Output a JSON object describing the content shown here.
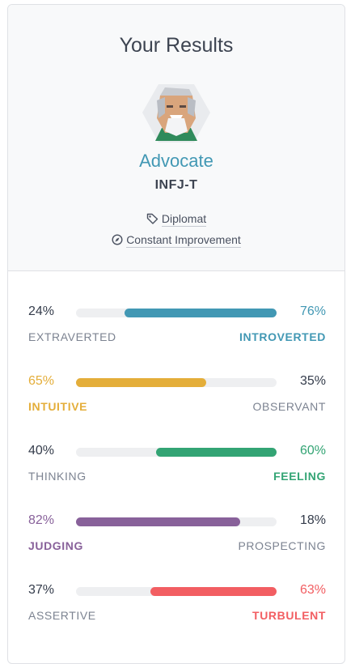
{
  "header": {
    "title": "Your Results",
    "personality_name": "Advocate",
    "code": "INFJ-T",
    "role": "Diplomat",
    "strategy": "Constant Improvement"
  },
  "colors": {
    "advocate": "#4298b4",
    "mind": "#4298b4",
    "energy": "#e4ae3a",
    "nature": "#33a474",
    "tactics": "#88619a",
    "identity": "#f25e62",
    "neutral_text": "#7c8391",
    "dark_text": "#343c4b"
  },
  "traits": [
    {
      "left_pct": "24%",
      "right_pct": "76%",
      "left_label": "EXTRAVERTED",
      "right_label": "INTROVERTED",
      "dominant": "right",
      "dominant_fraction": 0.76,
      "color": "#4298b4"
    },
    {
      "left_pct": "65%",
      "right_pct": "35%",
      "left_label": "INTUITIVE",
      "right_label": "OBSERVANT",
      "dominant": "left",
      "dominant_fraction": 0.65,
      "color": "#e4ae3a"
    },
    {
      "left_pct": "40%",
      "right_pct": "60%",
      "left_label": "THINKING",
      "right_label": "FEELING",
      "dominant": "right",
      "dominant_fraction": 0.6,
      "color": "#33a474"
    },
    {
      "left_pct": "82%",
      "right_pct": "18%",
      "left_label": "JUDGING",
      "right_label": "PROSPECTING",
      "dominant": "left",
      "dominant_fraction": 0.82,
      "color": "#88619a"
    },
    {
      "left_pct": "37%",
      "right_pct": "63%",
      "left_label": "ASSERTIVE",
      "right_label": "TURBULENT",
      "dominant": "right",
      "dominant_fraction": 0.63,
      "color": "#f25e62"
    }
  ],
  "icons": {
    "role": "tag-icon",
    "strategy": "compass-icon",
    "avatar": "advocate-avatar-icon"
  }
}
